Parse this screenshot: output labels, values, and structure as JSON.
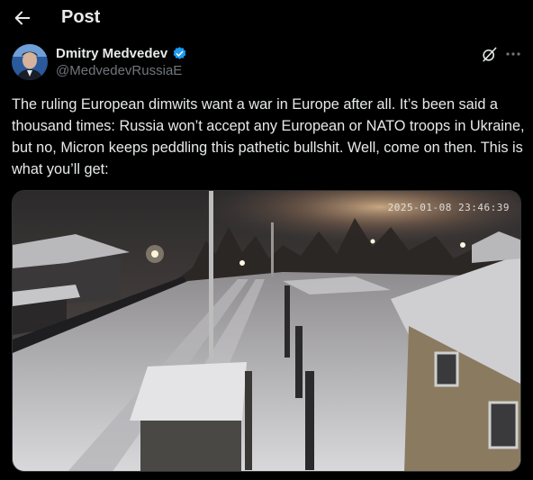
{
  "header": {
    "back_icon": "arrow-left-icon",
    "title": "Post"
  },
  "author": {
    "name": "Dmitry Medvedev",
    "handle": "@MedvedevRussiaE",
    "verified_icon": "verified-badge-icon",
    "verified_color": "#1d9bf0"
  },
  "actions": {
    "grok_icon": "grok-icon",
    "more_icon": "more-horizontal-icon"
  },
  "post": {
    "text": "The ruling European dimwits want a war in Europe after all. It’s been said a thousand times: Russia won’t accept any European or NATO troops in Ukraine, but no, Micron keeps peddling this pathetic bullshit. Well, come on then. This is what you’ll get:"
  },
  "media": {
    "timestamp": "2025-01-08 23:46:39"
  },
  "colors": {
    "background": "#000000",
    "text_primary": "#e7e9ea",
    "text_secondary": "#71767b"
  }
}
